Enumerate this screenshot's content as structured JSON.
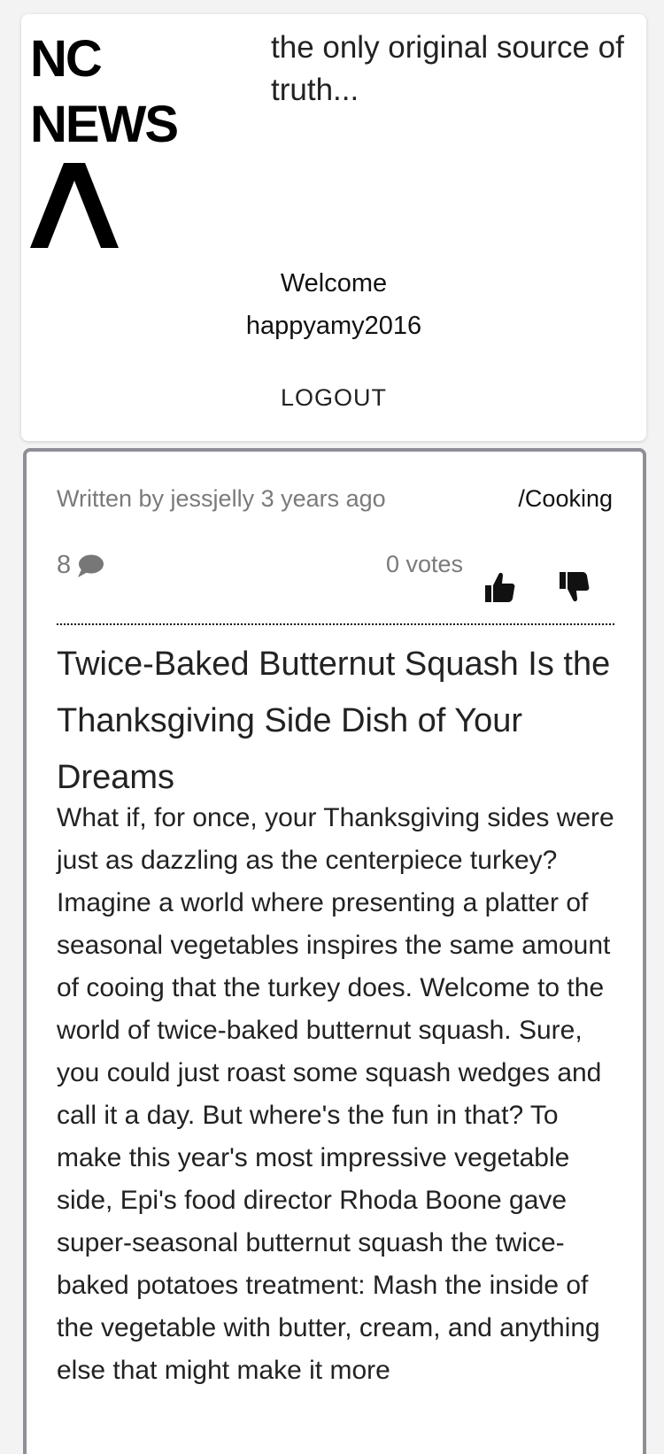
{
  "header": {
    "logo_line1": "NC",
    "logo_line2": "NEWS",
    "tagline": "the only original source of truth...",
    "welcome_label": "Welcome",
    "username": "happyamy2016",
    "logout_label": "LOGOUT"
  },
  "article": {
    "author_line": "Written by jessjelly 3 years ago",
    "topic": "/Cooking",
    "comment_count": "8",
    "votes_label": "0 votes",
    "title": "Twice-Baked Butternut Squash Is the Thanksgiving Side Dish of Your Dreams",
    "body": "What if, for once, your Thanksgiving sides were just as dazzling as the centerpiece turkey? Imagine a world where presenting a platter of seasonal vegetables inspires the same amount of cooing that the turkey does. Welcome to the world of twice-baked butternut squash. Sure, you could just roast some squash wedges and call it a day. But where's the fun in that? To make this year's most impressive vegetable side, Epi's food director Rhoda Boone gave super-seasonal butternut squash the twice-baked potatoes treatment: Mash the inside of the vegetable with butter, cream, and anything else that might make it more"
  },
  "icons": {
    "comment": "comment-icon",
    "upvote": "thumbs-up-icon",
    "downvote": "thumbs-down-icon",
    "logo_mark": "caret-up-icon"
  },
  "colors": {
    "card_border": "#8e8e96",
    "muted_text": "#7a7a7a"
  }
}
